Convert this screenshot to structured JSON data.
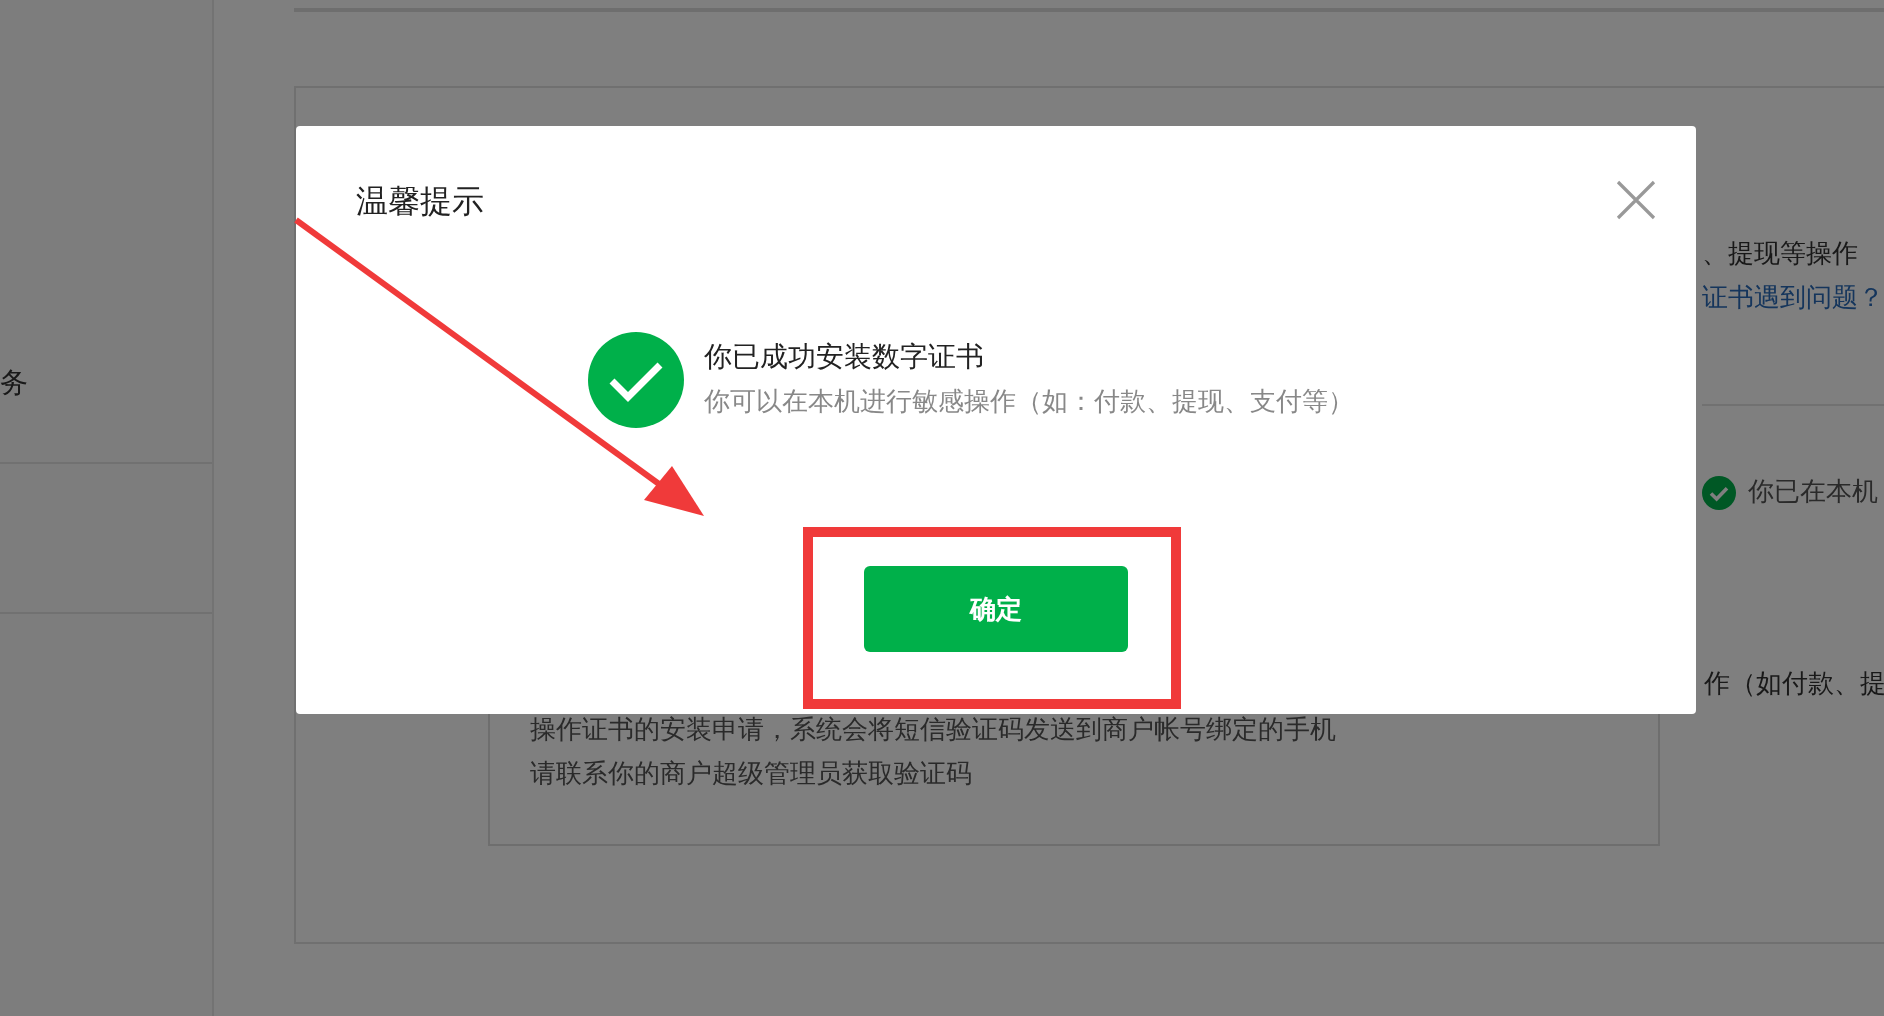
{
  "sidebar": {
    "items": [
      {
        "label": "务"
      }
    ]
  },
  "page": {
    "notice_line": "、提现等操作",
    "help_link": "证书遇到问题？",
    "status": "你已在本机",
    "right_note": "作（如付款、提",
    "box_lines": [
      "操作证书的安装申请，系统会将短信验证码发送到商户帐号绑定的手机",
      "请联系你的商户超级管理员获取验证码"
    ]
  },
  "dialog": {
    "title": "温馨提示",
    "message": "你已成功安装数字证书",
    "detail": "你可以在本机进行敏感操作（如：付款、提现、支付等）",
    "confirm_button": "确定"
  }
}
